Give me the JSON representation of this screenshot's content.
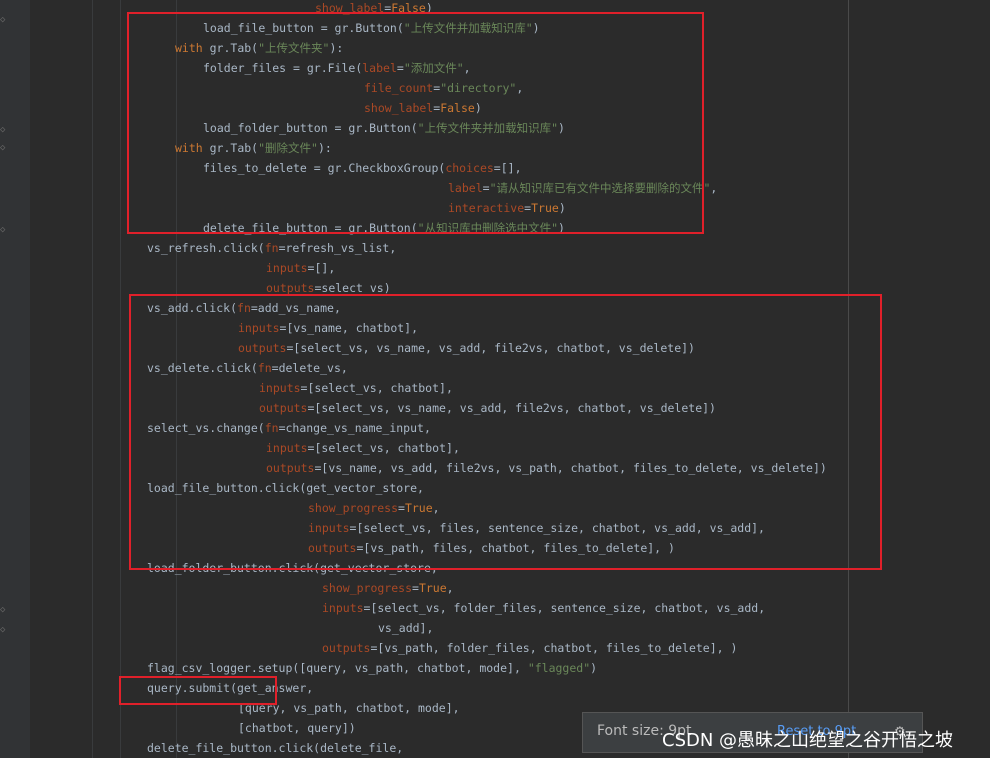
{
  "editor": {
    "lines": [
      [
        [
          "show_label",
          "p"
        ],
        [
          "=",
          "t"
        ],
        [
          "False",
          "b"
        ],
        [
          ")",
          "t"
        ]
      ],
      [
        [
          "load_file_button = gr.Button(",
          "t"
        ],
        [
          "\"上传文件并加载知识库\"",
          "s"
        ],
        [
          ")",
          "t"
        ]
      ],
      [
        [
          "with ",
          "k"
        ],
        [
          "gr.Tab(",
          "t"
        ],
        [
          "\"上传文件夹\"",
          "s"
        ],
        [
          "):",
          "t"
        ]
      ],
      [
        [
          "folder_files = gr.File(",
          "t"
        ],
        [
          "label",
          "p"
        ],
        [
          "=",
          "t"
        ],
        [
          "\"添加文件\"",
          "s"
        ],
        [
          ",",
          "t"
        ]
      ],
      [
        [
          "file_count",
          "p"
        ],
        [
          "=",
          "t"
        ],
        [
          "\"directory\"",
          "s"
        ],
        [
          ",",
          "t"
        ]
      ],
      [
        [
          "show_label",
          "p"
        ],
        [
          "=",
          "t"
        ],
        [
          "False",
          "b"
        ],
        [
          ")",
          "t"
        ]
      ],
      [
        [
          "load_folder_button = gr.Button(",
          "t"
        ],
        [
          "\"上传文件夹并加载知识库\"",
          "s"
        ],
        [
          ")",
          "t"
        ]
      ],
      [
        [
          "with ",
          "k"
        ],
        [
          "gr.Tab(",
          "t"
        ],
        [
          "\"删除文件\"",
          "s"
        ],
        [
          "):",
          "t"
        ]
      ],
      [
        [
          "files_to_delete = gr.CheckboxGroup(",
          "t"
        ],
        [
          "choices",
          "p"
        ],
        [
          "=[],",
          "t"
        ]
      ],
      [
        [
          "label",
          "p"
        ],
        [
          "=",
          "t"
        ],
        [
          "\"请从知识库已有文件中选择要删除的文件\"",
          "s"
        ],
        [
          ",",
          "t"
        ]
      ],
      [
        [
          "interactive",
          "p"
        ],
        [
          "=",
          "t"
        ],
        [
          "True",
          "b"
        ],
        [
          ")",
          "t"
        ]
      ],
      [
        [
          "delete_file_button = gr.Button(",
          "t"
        ],
        [
          "\"从知识库中删除选中文件\"",
          "s"
        ],
        [
          ")",
          "t"
        ]
      ],
      [
        [
          "vs_refresh.click(",
          "t"
        ],
        [
          "fn",
          "p"
        ],
        [
          "=refresh_vs_list,",
          "t"
        ]
      ],
      [
        [
          "inputs",
          "p"
        ],
        [
          "=[],",
          "t"
        ]
      ],
      [
        [
          "outputs",
          "p"
        ],
        [
          "=select_vs)",
          "t"
        ]
      ],
      [
        [
          "vs_add.click(",
          "t"
        ],
        [
          "fn",
          "p"
        ],
        [
          "=add_vs_name,",
          "t"
        ]
      ],
      [
        [
          "inputs",
          "p"
        ],
        [
          "=[vs_name, chatbot],",
          "t"
        ]
      ],
      [
        [
          "outputs",
          "p"
        ],
        [
          "=[select_vs, vs_name, vs_add, file2vs, chatbot, vs_delete])",
          "t"
        ]
      ],
      [
        [
          "vs_delete.click(",
          "t"
        ],
        [
          "fn",
          "p"
        ],
        [
          "=delete_vs,",
          "t"
        ]
      ],
      [
        [
          "inputs",
          "p"
        ],
        [
          "=[select_vs, chatbot],",
          "t"
        ]
      ],
      [
        [
          "outputs",
          "p"
        ],
        [
          "=[select_vs, vs_name, vs_add, file2vs, chatbot, vs_delete])",
          "t"
        ]
      ],
      [
        [
          "select_vs.change(",
          "t"
        ],
        [
          "fn",
          "p"
        ],
        [
          "=change_vs_name_input,",
          "t"
        ]
      ],
      [
        [
          "inputs",
          "p"
        ],
        [
          "=[select_vs, chatbot],",
          "t"
        ]
      ],
      [
        [
          "outputs",
          "p"
        ],
        [
          "=[vs_name, vs_add, file2vs, vs_path, chatbot, files_to_delete, vs_delete])",
          "t"
        ]
      ],
      [
        [
          "load_file_button.click(get_vector_store,",
          "t"
        ]
      ],
      [
        [
          "show_progress",
          "p"
        ],
        [
          "=",
          "t"
        ],
        [
          "True",
          "b"
        ],
        [
          ",",
          "t"
        ]
      ],
      [
        [
          "inputs",
          "p"
        ],
        [
          "=[select_vs, files, sentence_size, chatbot, vs_add, vs_add],",
          "t"
        ]
      ],
      [
        [
          "outputs",
          "p"
        ],
        [
          "=[vs_path, files, chatbot, files_to_delete], )",
          "t"
        ]
      ],
      [
        [
          "load_folder_button.click(get_vector_store,",
          "t"
        ]
      ],
      [
        [
          "show_progress",
          "p"
        ],
        [
          "=",
          "t"
        ],
        [
          "True",
          "b"
        ],
        [
          ",",
          "t"
        ]
      ],
      [
        [
          "inputs",
          "p"
        ],
        [
          "=[select_vs, folder_files, sentence_size, chatbot, vs_add,",
          "t"
        ]
      ],
      [
        [
          "vs_add],",
          "t"
        ]
      ],
      [
        [
          "outputs",
          "p"
        ],
        [
          "=[vs_path, folder_files, chatbot, files_to_delete], )",
          "t"
        ]
      ],
      [
        [
          "flag_csv_logger.setup([query, vs_path, chatbot, mode], ",
          "t"
        ],
        [
          "\"flagged\"",
          "s"
        ],
        [
          ")",
          "t"
        ]
      ],
      [
        [
          "query.submit(get_answer,",
          "t"
        ]
      ],
      [
        [
          "[query, vs_path, chatbot, mode],",
          "t"
        ]
      ],
      [
        [
          "[chatbot, query])",
          "t"
        ]
      ],
      [
        [
          "delete_file_button.click(delete_file,",
          "t"
        ]
      ]
    ]
  },
  "tooltip": {
    "label": "Font size: 9pt",
    "reset": "Reset to 9pt",
    "icon": "gear-icon"
  },
  "watermark": "CSDN @愚昧之山绝望之谷开悟之坡",
  "colors": {
    "background": "#2b2b2b",
    "annotation": "#e0202a",
    "keyword": "#cc7832",
    "string": "#6a8759",
    "param": "#aa4926",
    "text": "#a9b7c6"
  }
}
